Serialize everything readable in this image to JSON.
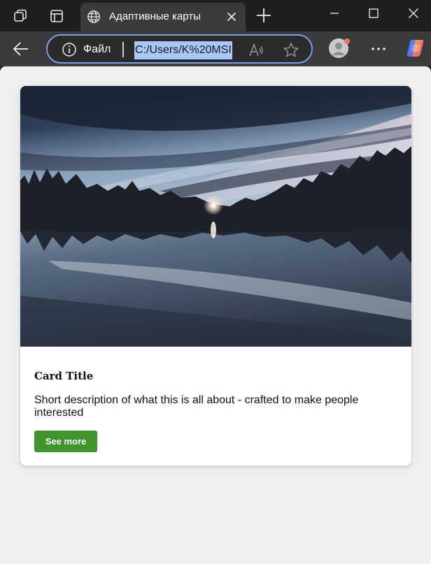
{
  "browser": {
    "tab": {
      "title": "Адаптивные карты"
    },
    "address_bar": {
      "site_label": "Файл",
      "url": "C:/Users/K%20MSI"
    }
  },
  "card": {
    "image_description": "Lake reflecting trees and evening sky",
    "title": "Card Title",
    "description": "Short description of what this is all about - crafted to make people interested",
    "button_label": "See more"
  },
  "colors": {
    "accent_button": "#3e962d",
    "address_focus": "#7aa0e8",
    "url_selection": "#a8c7fa"
  }
}
